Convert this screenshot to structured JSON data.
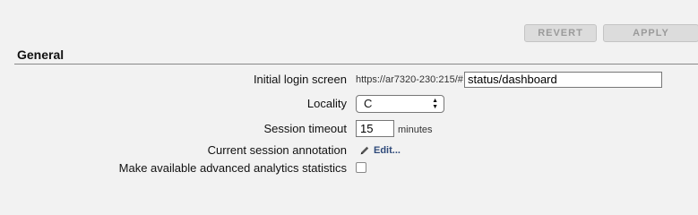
{
  "toolbar": {
    "revert_label": "REVERT",
    "apply_label": "APPLY"
  },
  "section": {
    "title": "General"
  },
  "fields": {
    "initial_login": {
      "label": "Initial login screen",
      "prefix": "https://ar7320-230:215/#",
      "value": "status/dashboard"
    },
    "locality": {
      "label": "Locality",
      "value": "C"
    },
    "session_timeout": {
      "label": "Session timeout",
      "value": "15",
      "unit": "minutes"
    },
    "annotation": {
      "label": "Current session annotation",
      "edit_label": "Edit...",
      "icon": "pencil-icon"
    },
    "analytics": {
      "label": "Make available advanced analytics statistics",
      "checked": false
    }
  }
}
